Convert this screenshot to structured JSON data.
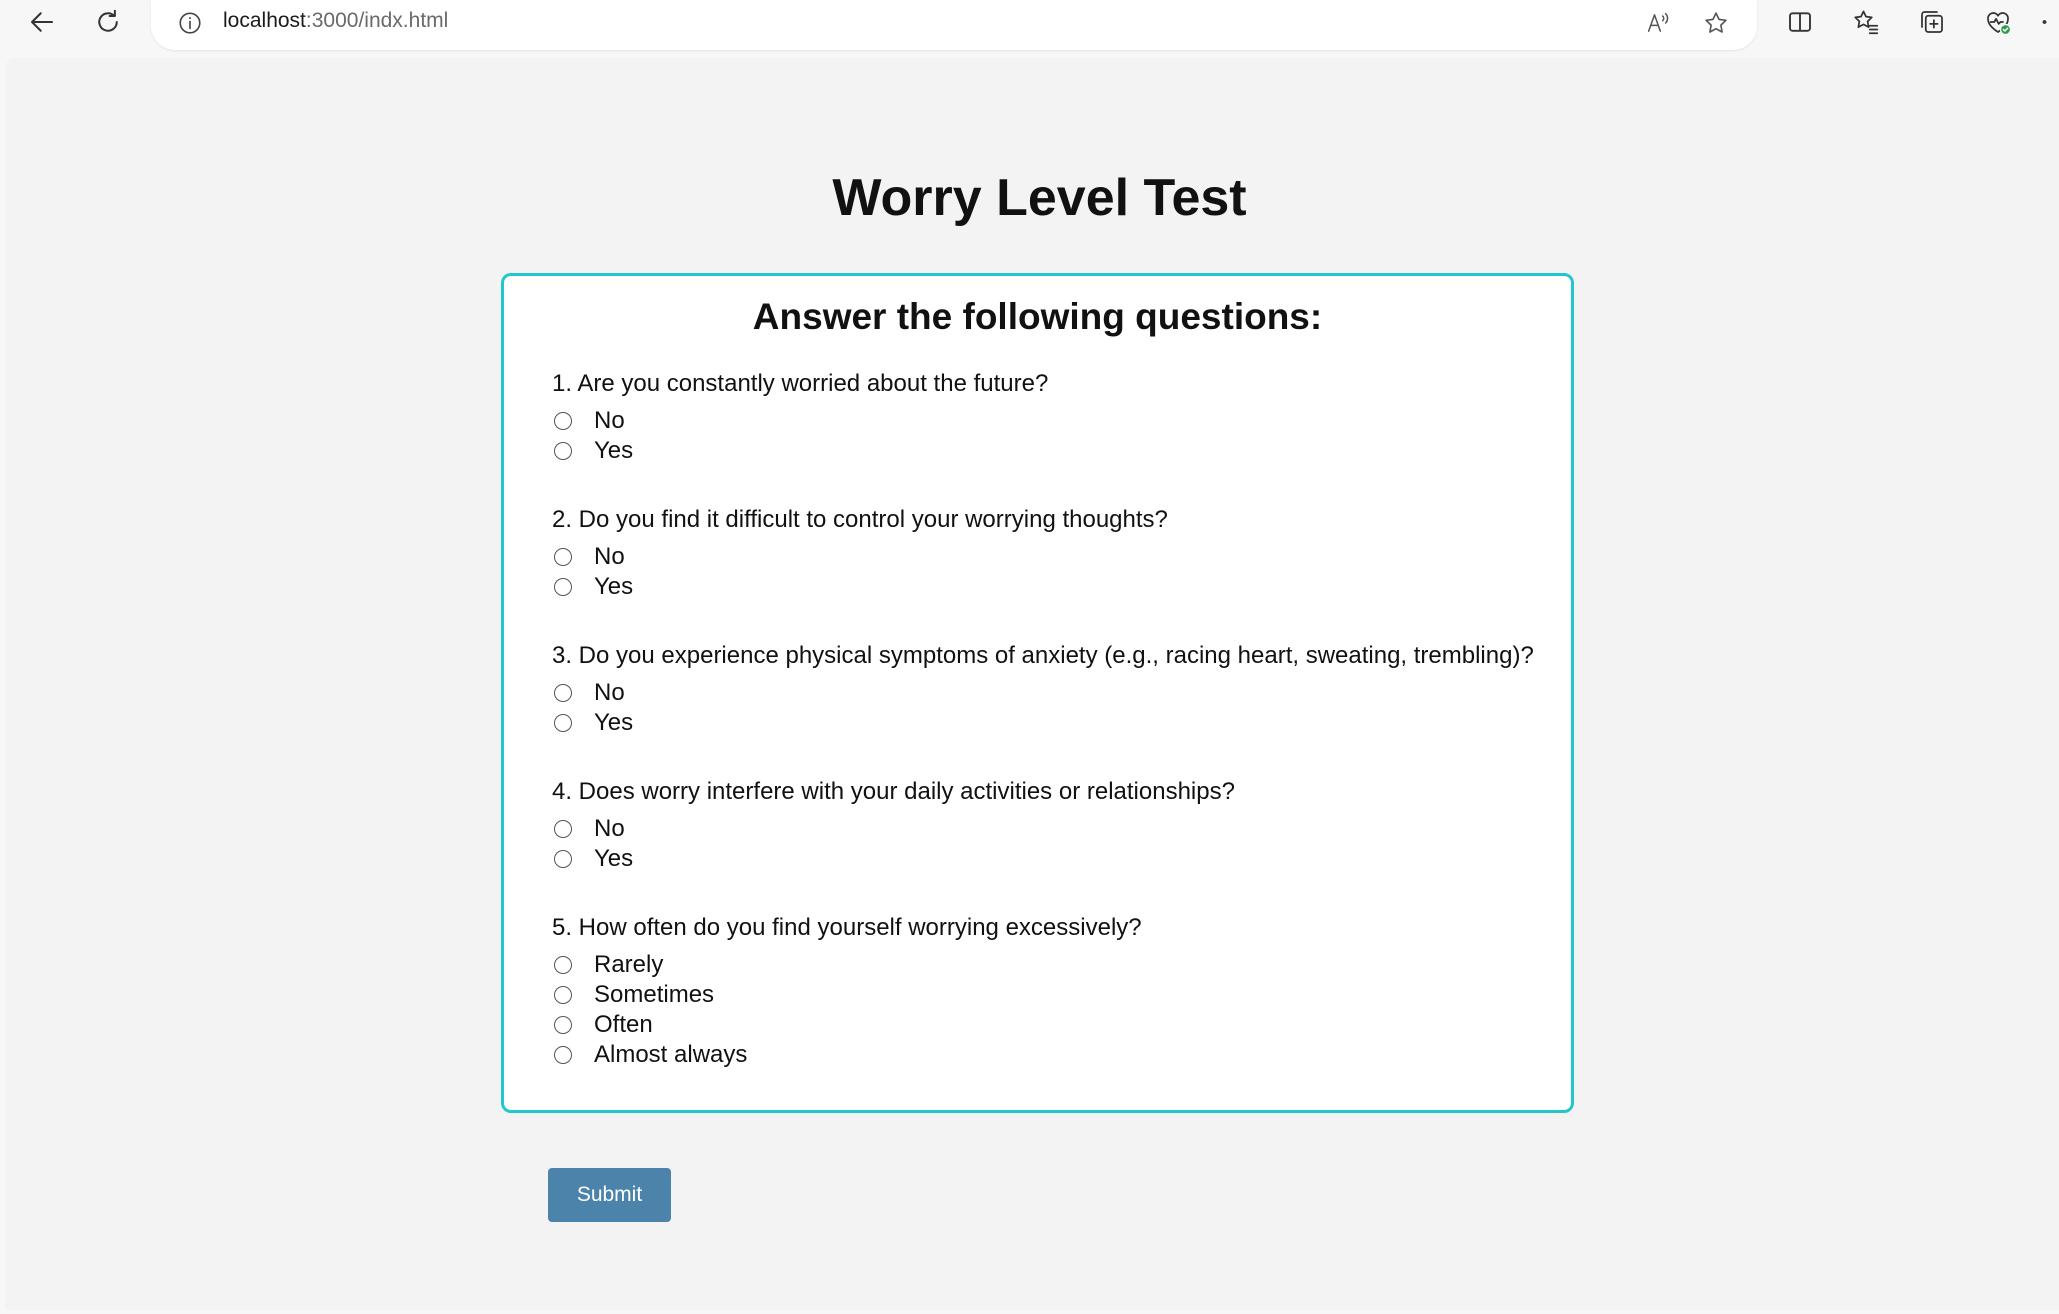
{
  "browser": {
    "url_host": "localhost",
    "url_rest": ":3000/indx.html",
    "icons": [
      "back-arrow-icon",
      "refresh-icon",
      "site-info-icon",
      "read-aloud-icon",
      "favorite-star-icon",
      "split-screen-icon",
      "favorites-icon",
      "collections-icon",
      "browser-essentials-icon",
      "more-icon"
    ]
  },
  "page": {
    "title": "Worry Level Test",
    "card_title": "Answer the following questions:",
    "questions": [
      {
        "text": "1. Are you constantly worried about the future?",
        "options": [
          "No",
          "Yes"
        ]
      },
      {
        "text": "2. Do you find it difficult to control your worrying thoughts?",
        "options": [
          "No",
          "Yes"
        ]
      },
      {
        "text": "3. Do you experience physical symptoms of anxiety (e.g., racing heart, sweating, trembling)?",
        "options": [
          "No",
          "Yes"
        ]
      },
      {
        "text": "4. Does worry interfere with your daily activities or relationships?",
        "options": [
          "No",
          "Yes"
        ]
      },
      {
        "text": "5. How often do you find yourself worrying excessively?",
        "options": [
          "Rarely",
          "Sometimes",
          "Often",
          "Almost always"
        ]
      }
    ],
    "submit_label": "Submit"
  },
  "colors": {
    "card_border": "#22c6cf",
    "submit_bg": "#4c83ab",
    "page_bg": "#f2f3f2"
  }
}
